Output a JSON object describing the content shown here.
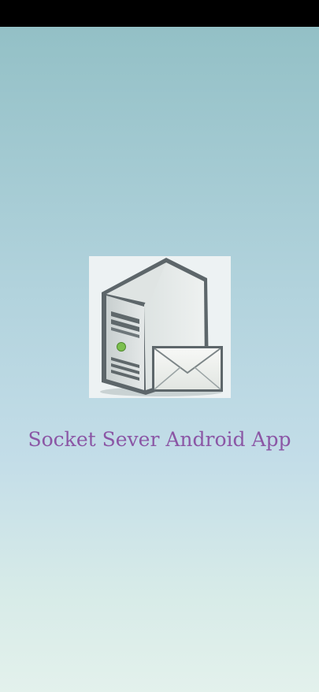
{
  "app": {
    "title": "Socket Sever Android App",
    "title_color": "#8b56a5"
  },
  "logo": {
    "icon": "server-mail-icon"
  },
  "theme": {
    "status_bar_color": "#000000",
    "background_top": "#93c0c6",
    "background_bottom": "#e3f1ec"
  }
}
